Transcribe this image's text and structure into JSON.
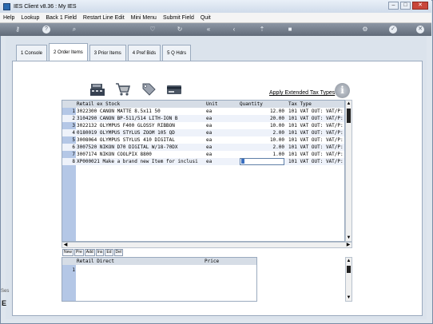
{
  "window": {
    "title": "IES Client v8.36 : My IES"
  },
  "menu": [
    "Help",
    "Lookup",
    "Back 1 Field",
    "Restart Line Edit",
    "Mini Menu",
    "Submit Field",
    "Quit"
  ],
  "tabs": [
    {
      "label": "1 Console",
      "active": false
    },
    {
      "label": "2 Order Items",
      "active": true
    },
    {
      "label": "3 Prior Items",
      "active": false
    },
    {
      "label": "4 Pref Bids",
      "active": false
    },
    {
      "label": "5 Q Hdrs",
      "active": false
    }
  ],
  "extended_tax_label": "Apply Extended Tax Types",
  "grid": {
    "headers": {
      "desc": "Retail ex Stock",
      "unit": "Unit",
      "qty": "Quantity",
      "tax": "Tax Type"
    },
    "rows": [
      {
        "num": "1",
        "desc": "3022300 CANON MATTE 8.5x11 50",
        "unit": "ea",
        "qty": "12.00",
        "tax": "101 VAT OUT: VAT/P:"
      },
      {
        "num": "2",
        "desc": "3104290 CANON BP-511/514 LITH-ION B",
        "unit": "ea",
        "qty": "20.00",
        "tax": "101 VAT OUT: VAT/P:"
      },
      {
        "num": "3",
        "desc": "3022132 OLYMPUS F400 GLOSSY RIBBON",
        "unit": "ea",
        "qty": "10.00",
        "tax": "101 VAT OUT: VAT/P:"
      },
      {
        "num": "4",
        "desc": "0180019 OLYMPUS STYLUS ZOOM 105 QD",
        "unit": "ea",
        "qty": "2.00",
        "tax": "101 VAT OUT: VAT/P:"
      },
      {
        "num": "5",
        "desc": "3008064 OLYMPUS STYLUS 410 DIGITAL",
        "unit": "ea",
        "qty": "10.00",
        "tax": "101 VAT OUT: VAT/P:"
      },
      {
        "num": "6",
        "desc": "3007520 NIKON D70 DIGITAL W/18-70DX",
        "unit": "ea",
        "qty": "2.00",
        "tax": "101 VAT OUT: VAT/P:"
      },
      {
        "num": "7",
        "desc": "3007174 NIKON COOLPIX 8800",
        "unit": "ea",
        "qty": "1.00",
        "tax": "101 VAT OUT: VAT/P:"
      },
      {
        "num": "8",
        "desc": "XP000021 Make a brand new Item for inclusi",
        "unit": "ea",
        "qty": "",
        "tax": "101 VAT OUT: VAT/P:"
      }
    ]
  },
  "row_actions": [
    "New",
    "Pre",
    "Add",
    "Ins",
    "Ed",
    "Del"
  ],
  "subgrid": {
    "headers": {
      "desc": "Retail Direct",
      "price": "Price"
    },
    "rows": [
      {
        "num": "1",
        "desc": "",
        "price": ""
      }
    ]
  },
  "side_labels": {
    "small": "Ses",
    "large": "E"
  }
}
